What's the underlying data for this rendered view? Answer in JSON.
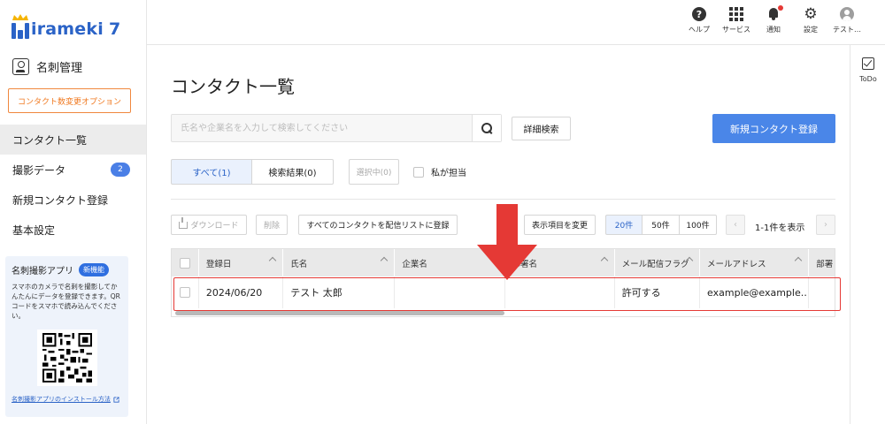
{
  "brand": {
    "logo_text": "irameki",
    "logo_num": "7",
    "accent": "#2b63c7"
  },
  "sidebar": {
    "section_title": "名刺管理",
    "option_button": "コンタクト数変更オプション",
    "items": [
      {
        "label": "コンタクト一覧"
      },
      {
        "label": "撮影データ",
        "badge": "2"
      },
      {
        "label": "新規コンタクト登録"
      },
      {
        "label": "基本設定"
      }
    ],
    "app": {
      "title": "名刺撮影アプリ",
      "badge": "新機能",
      "desc": "スマホのカメラで名刺を撮影してかんたんにデータを登録できます。QRコードをスマホで読み込んでください。",
      "link": "名刺撮影アプリのインストール方法"
    }
  },
  "topbar": {
    "help": "ヘルプ",
    "services": "サービス",
    "notifications": "通知",
    "settings": "設定",
    "user": "テスト…"
  },
  "rail": {
    "todo": "ToDo"
  },
  "main": {
    "title": "コンタクト一覧",
    "search_placeholder": "氏名や企業名を入力して検索してください",
    "advanced_search": "詳細検索",
    "new_contact": "新規コンタクト登録",
    "tab_all": "すべて(1)",
    "tab_results": "検索結果(0)",
    "selected": "選択中(0)",
    "mine": "私が担当",
    "download": "ダウンロード",
    "delete": "削除",
    "add_all_to_list": "すべてのコンタクトを配信リストに登録",
    "change_columns": "表示項目を変更",
    "page_sizes": [
      "20件",
      "50件",
      "100件"
    ],
    "range_info": "1-1件を表示",
    "prev": "‹",
    "next": "›"
  },
  "table": {
    "headers": [
      "登録日",
      "氏名",
      "企業名",
      "部署名",
      "メール配信フラグ",
      "メールアドレス",
      "部署"
    ],
    "rows": [
      {
        "date": "2024/06/20",
        "name": "テスト 太郎",
        "company": "",
        "department": "",
        "mail_flag": "許可する",
        "email": "example@example.…"
      }
    ]
  },
  "colors": {
    "primary": "#4a86e8",
    "highlight": "#e53935",
    "option_border": "#f0883e"
  }
}
